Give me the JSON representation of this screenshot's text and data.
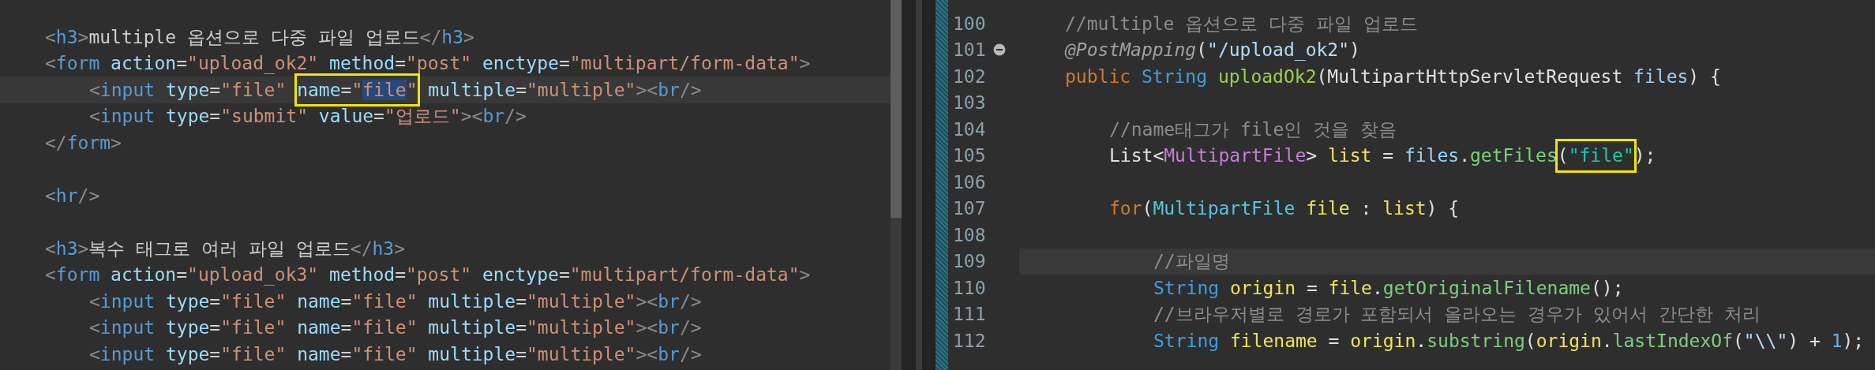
{
  "left_editor": {
    "lines": [
      {
        "current": false,
        "indented": false,
        "segments": [
          {
            "boxed": false,
            "tokens": [
              {
                "kind": "bracket",
                "text": "<"
              },
              {
                "kind": "tag",
                "text": "h3"
              },
              {
                "kind": "bracket",
                "text": ">"
              },
              {
                "kind": "text",
                "text": "multiple 옵션으로 다중 파일 업로드"
              },
              {
                "kind": "bracket",
                "text": "</"
              },
              {
                "kind": "tag",
                "text": "h3"
              },
              {
                "kind": "bracket",
                "text": ">"
              }
            ]
          }
        ]
      },
      {
        "current": false,
        "indented": false,
        "segments": [
          {
            "boxed": false,
            "tokens": [
              {
                "kind": "bracket",
                "text": "<"
              },
              {
                "kind": "tag",
                "text": "form"
              },
              {
                "kind": "attr",
                "text": " action"
              },
              {
                "kind": "text",
                "text": "="
              },
              {
                "kind": "value",
                "text": "\"upload_ok2\""
              },
              {
                "kind": "attr",
                "text": " method"
              },
              {
                "kind": "text",
                "text": "="
              },
              {
                "kind": "value",
                "text": "\"post\""
              },
              {
                "kind": "attr",
                "text": " enctype"
              },
              {
                "kind": "text",
                "text": "="
              },
              {
                "kind": "value",
                "text": "\"multipart/form-data\""
              },
              {
                "kind": "bracket",
                "text": ">"
              }
            ]
          }
        ]
      },
      {
        "current": true,
        "indented": true,
        "segments": [
          {
            "boxed": false,
            "tokens": [
              {
                "kind": "bracket",
                "text": "<"
              },
              {
                "kind": "tag",
                "text": "input"
              },
              {
                "kind": "attr",
                "text": " type"
              },
              {
                "kind": "text",
                "text": "="
              },
              {
                "kind": "value",
                "text": "\"file\" "
              }
            ]
          },
          {
            "boxed": true,
            "tokens": [
              {
                "kind": "attr",
                "text": "name",
                "selected": false
              },
              {
                "kind": "text",
                "text": "=",
                "selected": false
              },
              {
                "kind": "value",
                "text": "\"",
                "selected": false
              },
              {
                "kind": "value",
                "text": "file",
                "selected": true
              },
              {
                "kind": "value",
                "text": "\"",
                "selected": false
              }
            ]
          },
          {
            "boxed": false,
            "tokens": [
              {
                "kind": "attr",
                "text": " multiple"
              },
              {
                "kind": "text",
                "text": "="
              },
              {
                "kind": "value",
                "text": "\"multiple\""
              },
              {
                "kind": "bracket",
                "text": ">"
              },
              {
                "kind": "bracket",
                "text": "<"
              },
              {
                "kind": "tag",
                "text": "br"
              },
              {
                "kind": "bracket",
                "text": "/>"
              }
            ]
          }
        ]
      },
      {
        "current": false,
        "indented": true,
        "segments": [
          {
            "boxed": false,
            "tokens": [
              {
                "kind": "bracket",
                "text": "<"
              },
              {
                "kind": "tag",
                "text": "input"
              },
              {
                "kind": "attr",
                "text": " type"
              },
              {
                "kind": "text",
                "text": "="
              },
              {
                "kind": "value",
                "text": "\"submit\""
              },
              {
                "kind": "attr",
                "text": " value"
              },
              {
                "kind": "text",
                "text": "="
              },
              {
                "kind": "value",
                "text": "\"업로드\""
              },
              {
                "kind": "bracket",
                "text": ">"
              },
              {
                "kind": "bracket",
                "text": "<"
              },
              {
                "kind": "tag",
                "text": "br"
              },
              {
                "kind": "bracket",
                "text": "/>"
              }
            ]
          }
        ]
      },
      {
        "current": false,
        "indented": false,
        "segments": [
          {
            "boxed": false,
            "tokens": [
              {
                "kind": "bracket",
                "text": "</"
              },
              {
                "kind": "tag",
                "text": "form"
              },
              {
                "kind": "bracket",
                "text": ">"
              }
            ]
          }
        ]
      },
      {
        "current": false
      },
      {
        "current": false,
        "indented": false,
        "segments": [
          {
            "boxed": false,
            "tokens": [
              {
                "kind": "bracket",
                "text": "<"
              },
              {
                "kind": "tag",
                "text": "hr"
              },
              {
                "kind": "bracket",
                "text": "/>"
              }
            ]
          }
        ]
      },
      {
        "current": false
      },
      {
        "current": false,
        "indented": false,
        "segments": [
          {
            "boxed": false,
            "tokens": [
              {
                "kind": "bracket",
                "text": "<"
              },
              {
                "kind": "tag",
                "text": "h3"
              },
              {
                "kind": "bracket",
                "text": ">"
              },
              {
                "kind": "text",
                "text": "복수 태그로 여러 파일 업로드"
              },
              {
                "kind": "bracket",
                "text": "</"
              },
              {
                "kind": "tag",
                "text": "h3"
              },
              {
                "kind": "bracket",
                "text": ">"
              }
            ]
          }
        ]
      },
      {
        "current": false,
        "indented": false,
        "segments": [
          {
            "boxed": false,
            "tokens": [
              {
                "kind": "bracket",
                "text": "<"
              },
              {
                "kind": "tag",
                "text": "form"
              },
              {
                "kind": "attr",
                "text": " action"
              },
              {
                "kind": "text",
                "text": "="
              },
              {
                "kind": "value",
                "text": "\"upload_ok3\""
              },
              {
                "kind": "attr",
                "text": " method"
              },
              {
                "kind": "text",
                "text": "="
              },
              {
                "kind": "value",
                "text": "\"post\""
              },
              {
                "kind": "attr",
                "text": " enctype"
              },
              {
                "kind": "text",
                "text": "="
              },
              {
                "kind": "value",
                "text": "\"multipart/form-data\""
              },
              {
                "kind": "bracket",
                "text": ">"
              }
            ]
          }
        ]
      },
      {
        "current": false,
        "indented": true,
        "segments": [
          {
            "boxed": false,
            "tokens": [
              {
                "kind": "bracket",
                "text": "<"
              },
              {
                "kind": "tag",
                "text": "input"
              },
              {
                "kind": "attr",
                "text": " type"
              },
              {
                "kind": "text",
                "text": "="
              },
              {
                "kind": "value",
                "text": "\"file\""
              },
              {
                "kind": "attr",
                "text": " name"
              },
              {
                "kind": "text",
                "text": "="
              },
              {
                "kind": "value",
                "text": "\"file\""
              },
              {
                "kind": "attr",
                "text": " multiple"
              },
              {
                "kind": "text",
                "text": "="
              },
              {
                "kind": "value",
                "text": "\"multiple\""
              },
              {
                "kind": "bracket",
                "text": ">"
              },
              {
                "kind": "bracket",
                "text": "<"
              },
              {
                "kind": "tag",
                "text": "br"
              },
              {
                "kind": "bracket",
                "text": "/>"
              }
            ]
          }
        ]
      },
      {
        "current": false,
        "indented": true,
        "segments": [
          {
            "boxed": false,
            "tokens": [
              {
                "kind": "bracket",
                "text": "<"
              },
              {
                "kind": "tag",
                "text": "input"
              },
              {
                "kind": "attr",
                "text": " type"
              },
              {
                "kind": "text",
                "text": "="
              },
              {
                "kind": "value",
                "text": "\"file\""
              },
              {
                "kind": "attr",
                "text": " name"
              },
              {
                "kind": "text",
                "text": "="
              },
              {
                "kind": "value",
                "text": "\"file\""
              },
              {
                "kind": "attr",
                "text": " multiple"
              },
              {
                "kind": "text",
                "text": "="
              },
              {
                "kind": "value",
                "text": "\"multiple\""
              },
              {
                "kind": "bracket",
                "text": ">"
              },
              {
                "kind": "bracket",
                "text": "<"
              },
              {
                "kind": "tag",
                "text": "br"
              },
              {
                "kind": "bracket",
                "text": "/>"
              }
            ]
          }
        ]
      },
      {
        "current": false,
        "indented": true,
        "segments": [
          {
            "boxed": false,
            "tokens": [
              {
                "kind": "bracket",
                "text": "<"
              },
              {
                "kind": "tag",
                "text": "input"
              },
              {
                "kind": "attr",
                "text": " type"
              },
              {
                "kind": "text",
                "text": "="
              },
              {
                "kind": "value",
                "text": "\"file\""
              },
              {
                "kind": "attr",
                "text": " name"
              },
              {
                "kind": "text",
                "text": "="
              },
              {
                "kind": "value",
                "text": "\"file\""
              },
              {
                "kind": "attr",
                "text": " multiple"
              },
              {
                "kind": "text",
                "text": "="
              },
              {
                "kind": "value",
                "text": "\"multiple\""
              },
              {
                "kind": "bracket",
                "text": ">"
              },
              {
                "kind": "bracket",
                "text": "<"
              },
              {
                "kind": "tag",
                "text": "br"
              },
              {
                "kind": "bracket",
                "text": "/>"
              }
            ]
          }
        ]
      }
    ]
  },
  "right_editor": {
    "lines": [
      {
        "number": "100",
        "fold": false,
        "current": false,
        "indented": false,
        "nested": false,
        "segments": [
          {
            "boxed": false,
            "tokens": [
              {
                "kind": "comment",
                "text": "//multiple 옵션으로 다중 파일 업로드"
              }
            ]
          }
        ]
      },
      {
        "number": "101",
        "fold": true,
        "current": false,
        "indented": false,
        "nested": false,
        "segments": [
          {
            "boxed": false,
            "tokens": [
              {
                "kind": "annotation",
                "text": "@PostMapping"
              },
              {
                "kind": "plain",
                "text": "("
              },
              {
                "kind": "string",
                "text": "\"/upload_ok2\""
              },
              {
                "kind": "plain",
                "text": ")"
              }
            ]
          }
        ]
      },
      {
        "number": "102",
        "fold": false,
        "current": false,
        "indented": false,
        "nested": false,
        "segments": [
          {
            "boxed": false,
            "tokens": [
              {
                "kind": "keyword",
                "text": "public"
              },
              {
                "kind": "type",
                "text": " String"
              },
              {
                "kind": "method",
                "text": " uploadOk2"
              },
              {
                "kind": "plain",
                "text": "(MultipartHttpServletRequest"
              },
              {
                "kind": "field",
                "text": " files"
              },
              {
                "kind": "plain",
                "text": ") {"
              }
            ]
          }
        ]
      },
      {
        "number": "103",
        "fold": false,
        "current": false
      },
      {
        "number": "104",
        "fold": false,
        "current": false,
        "indented": true,
        "nested": false,
        "segments": [
          {
            "boxed": false,
            "tokens": [
              {
                "kind": "comment",
                "text": "//name태그가 file인 것을 찾음"
              }
            ]
          }
        ]
      },
      {
        "number": "105",
        "fold": false,
        "current": false,
        "indented": true,
        "nested": false,
        "segments": [
          {
            "boxed": false,
            "tokens": [
              {
                "kind": "plain",
                "text": "List<"
              },
              {
                "kind": "generic",
                "text": "MultipartFile"
              },
              {
                "kind": "plain",
                "text": "> "
              },
              {
                "kind": "variable",
                "text": "list"
              },
              {
                "kind": "plain",
                "text": " = "
              },
              {
                "kind": "field",
                "text": "files"
              },
              {
                "kind": "plain",
                "text": "."
              },
              {
                "kind": "call",
                "text": "getFiles"
              }
            ]
          },
          {
            "boxed": true,
            "tokens": [
              {
                "kind": "plain",
                "text": "("
              },
              {
                "kind": "string2",
                "text": "\"file\""
              }
            ]
          },
          {
            "boxed": false,
            "tokens": [
              {
                "kind": "plain",
                "text": ");"
              }
            ]
          }
        ]
      },
      {
        "number": "106",
        "fold": false,
        "current": false
      },
      {
        "number": "107",
        "fold": false,
        "current": false,
        "indented": true,
        "nested": false,
        "segments": [
          {
            "boxed": false,
            "tokens": [
              {
                "kind": "keyword",
                "text": "for"
              },
              {
                "kind": "plain",
                "text": "("
              },
              {
                "kind": "class",
                "text": "MultipartFile"
              },
              {
                "kind": "variable",
                "text": " file"
              },
              {
                "kind": "plain",
                "text": " : "
              },
              {
                "kind": "variable",
                "text": "list"
              },
              {
                "kind": "plain",
                "text": ") {"
              }
            ]
          }
        ]
      },
      {
        "number": "108",
        "fold": false,
        "current": false
      },
      {
        "number": "109",
        "fold": false,
        "current": true,
        "indented": true,
        "nested": true,
        "segments": [
          {
            "boxed": false,
            "tokens": [
              {
                "kind": "comment",
                "text": "//파일명"
              }
            ]
          }
        ]
      },
      {
        "number": "110",
        "fold": false,
        "current": false,
        "indented": true,
        "nested": true,
        "segments": [
          {
            "boxed": false,
            "tokens": [
              {
                "kind": "type",
                "text": "String"
              },
              {
                "kind": "variable",
                "text": " origin"
              },
              {
                "kind": "plain",
                "text": " = "
              },
              {
                "kind": "variable",
                "text": "file"
              },
              {
                "kind": "plain",
                "text": "."
              },
              {
                "kind": "call",
                "text": "getOriginalFilename"
              },
              {
                "kind": "plain",
                "text": "();"
              }
            ]
          }
        ]
      },
      {
        "number": "111",
        "fold": false,
        "current": false,
        "indented": true,
        "nested": true,
        "segments": [
          {
            "boxed": false,
            "tokens": [
              {
                "kind": "comment",
                "text": "//브라우저별로 경로가 포함되서 올라오는 경우가 있어서 간단한 처리"
              }
            ]
          }
        ]
      },
      {
        "number": "112",
        "fold": false,
        "current": false,
        "indented": true,
        "nested": true,
        "segments": [
          {
            "boxed": false,
            "tokens": [
              {
                "kind": "type",
                "text": "String"
              },
              {
                "kind": "variable",
                "text": " filename"
              },
              {
                "kind": "plain",
                "text": " = "
              },
              {
                "kind": "variable",
                "text": "origin"
              },
              {
                "kind": "plain",
                "text": "."
              },
              {
                "kind": "call",
                "text": "substring"
              },
              {
                "kind": "plain",
                "text": "("
              },
              {
                "kind": "variable",
                "text": "origin"
              },
              {
                "kind": "plain",
                "text": "."
              },
              {
                "kind": "call",
                "text": "lastIndexOf"
              },
              {
                "kind": "plain",
                "text": "("
              },
              {
                "kind": "string",
                "text": "\"\\\\\""
              },
              {
                "kind": "plain",
                "text": ") + "
              },
              {
                "kind": "number",
                "text": "1"
              },
              {
                "kind": "plain",
                "text": ");"
              }
            ]
          }
        ]
      }
    ]
  }
}
